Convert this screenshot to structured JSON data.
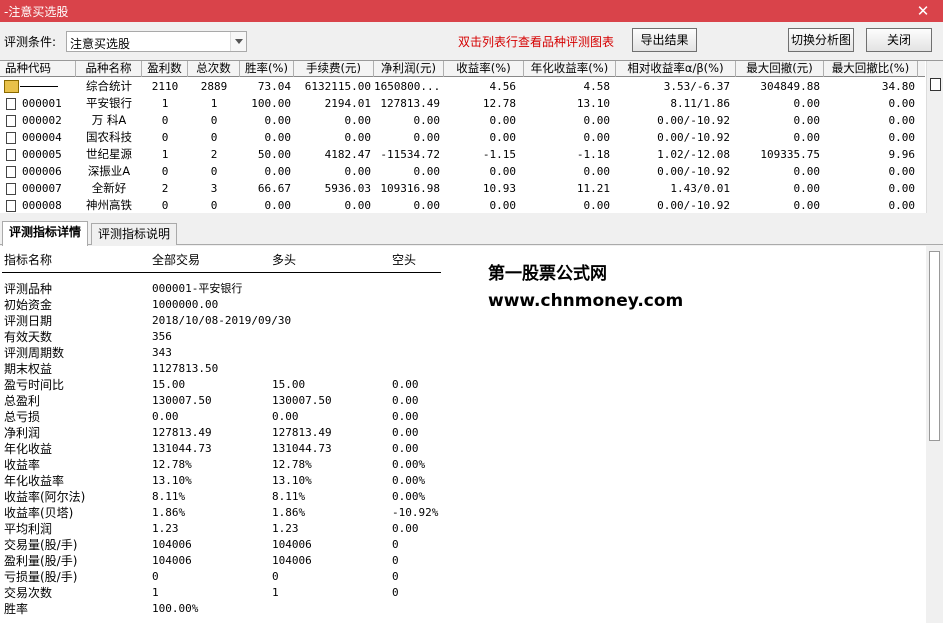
{
  "window": {
    "title": "-注意买选股",
    "close_glyph": "✕"
  },
  "toolbar": {
    "cond_label": "评测条件:",
    "cond_value": "注意买选股",
    "hint": "双击列表行查看品种评测图表",
    "export_label": "导出结果",
    "switch_label": "切换分析图",
    "close_label": "关闭"
  },
  "grid": {
    "headers": [
      "品种代码",
      "品种名称",
      "盈利数",
      "总次数",
      "胜率(%)",
      "手续费(元)",
      "净利润(元)",
      "收益率(%)",
      "年化收益率(%)",
      "相对收益率α/β(%)",
      "最大回撤(元)",
      "最大回撤比(%)"
    ],
    "rows": [
      {
        "code": "",
        "name": "综合统计",
        "win": "2110",
        "total": "2889",
        "rate": "73.04",
        "fee": "6132115.00",
        "profit": "1650800...",
        "ret": "4.56",
        "annual": "4.58",
        "alpha": "3.53/-6.37",
        "dd": "304849.88",
        "ddr": "34.80",
        "summary": true
      },
      {
        "code": "000001",
        "name": "平安银行",
        "win": "1",
        "total": "1",
        "rate": "100.00",
        "fee": "2194.01",
        "profit": "127813.49",
        "ret": "12.78",
        "annual": "13.10",
        "alpha": "8.11/1.86",
        "dd": "0.00",
        "ddr": "0.00"
      },
      {
        "code": "000002",
        "name": "万 科A",
        "win": "0",
        "total": "0",
        "rate": "0.00",
        "fee": "0.00",
        "profit": "0.00",
        "ret": "0.00",
        "annual": "0.00",
        "alpha": "0.00/-10.92",
        "dd": "0.00",
        "ddr": "0.00"
      },
      {
        "code": "000004",
        "name": "国农科技",
        "win": "0",
        "total": "0",
        "rate": "0.00",
        "fee": "0.00",
        "profit": "0.00",
        "ret": "0.00",
        "annual": "0.00",
        "alpha": "0.00/-10.92",
        "dd": "0.00",
        "ddr": "0.00"
      },
      {
        "code": "000005",
        "name": "世纪星源",
        "win": "1",
        "total": "2",
        "rate": "50.00",
        "fee": "4182.47",
        "profit": "-11534.72",
        "ret": "-1.15",
        "annual": "-1.18",
        "alpha": "1.02/-12.08",
        "dd": "109335.75",
        "ddr": "9.96"
      },
      {
        "code": "000006",
        "name": "深振业A",
        "win": "0",
        "total": "0",
        "rate": "0.00",
        "fee": "0.00",
        "profit": "0.00",
        "ret": "0.00",
        "annual": "0.00",
        "alpha": "0.00/-10.92",
        "dd": "0.00",
        "ddr": "0.00"
      },
      {
        "code": "000007",
        "name": "全新好",
        "win": "2",
        "total": "3",
        "rate": "66.67",
        "fee": "5936.03",
        "profit": "109316.98",
        "ret": "10.93",
        "annual": "11.21",
        "alpha": "1.43/0.01",
        "dd": "0.00",
        "ddr": "0.00"
      },
      {
        "code": "000008",
        "name": "神州高铁",
        "win": "0",
        "total": "0",
        "rate": "0.00",
        "fee": "0.00",
        "profit": "0.00",
        "ret": "0.00",
        "annual": "0.00",
        "alpha": "0.00/-10.92",
        "dd": "0.00",
        "ddr": "0.00"
      }
    ]
  },
  "tabs": [
    "评测指标详情",
    "评测指标说明"
  ],
  "detail": {
    "headers": [
      "指标名称",
      "全部交易",
      "多头",
      "空头"
    ],
    "rows": [
      [
        "评测品种",
        "000001-平安银行",
        "",
        ""
      ],
      [
        "初始资金",
        "1000000.00",
        "",
        ""
      ],
      [
        "评测日期",
        "2018/10/08-2019/09/30",
        "",
        ""
      ],
      [
        "有效天数",
        "356",
        "",
        ""
      ],
      [
        "评测周期数",
        "343",
        "",
        ""
      ],
      [
        "期末权益",
        "1127813.50",
        "",
        ""
      ],
      [
        "盈亏时间比",
        "15.00",
        "15.00",
        "0.00"
      ],
      [
        "总盈利",
        "130007.50",
        "130007.50",
        "0.00"
      ],
      [
        "总亏损",
        "0.00",
        "0.00",
        "0.00"
      ],
      [
        "净利润",
        "127813.49",
        "127813.49",
        "0.00"
      ],
      [
        "年化收益",
        "131044.73",
        "131044.73",
        "0.00"
      ],
      [
        "收益率",
        "12.78%",
        "12.78%",
        "0.00%"
      ],
      [
        "年化收益率",
        "13.10%",
        "13.10%",
        "0.00%"
      ],
      [
        "收益率(阿尔法)",
        "8.11%",
        "8.11%",
        "0.00%"
      ],
      [
        "收益率(贝塔)",
        "1.86%",
        "1.86%",
        "-10.92%"
      ],
      [
        "平均利润",
        "1.23",
        "1.23",
        "0.00"
      ],
      [
        "交易量(股/手)",
        "104006",
        "104006",
        "0"
      ],
      [
        "盈利量(股/手)",
        "104006",
        "104006",
        "0"
      ],
      [
        "亏损量(股/手)",
        "0",
        "0",
        "0"
      ],
      [
        "交易次数",
        "1",
        "1",
        "0"
      ],
      [
        "胜率",
        "100.00%",
        "",
        ""
      ]
    ]
  },
  "watermark": {
    "line1": "第一股票公式网",
    "line2": "www.chnmoney.com"
  }
}
